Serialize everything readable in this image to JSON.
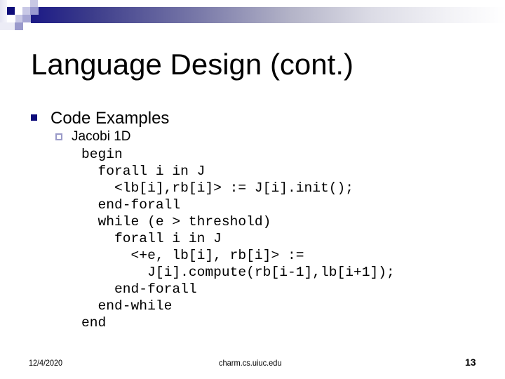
{
  "slide": {
    "title": "Language Design (cont.)",
    "bullets": [
      {
        "text": "Code Examples",
        "sub_bullets": [
          {
            "text": "Jacobi 1D",
            "code_lines": [
              "begin",
              "  forall i in J",
              "    <lb[i],rb[i]> := J[i].init();",
              "  end-forall",
              "  while (e > threshold)",
              "    forall i in J",
              "      <+e, lb[i], rb[i]> :=",
              "        J[i].compute(rb[i-1],lb[i+1]);",
              "    end-forall",
              "  end-while",
              "end"
            ]
          }
        ]
      }
    ],
    "footer": {
      "date": "12/4/2020",
      "url": "charm.cs.uiuc.edu",
      "page_number": "13"
    },
    "colors": {
      "accent_navy": "#0e0c7a",
      "sub_bullet_border": "#9a9ac8"
    },
    "icons": {
      "level1_bullet": "filled-square",
      "level2_bullet": "hollow-square"
    }
  }
}
